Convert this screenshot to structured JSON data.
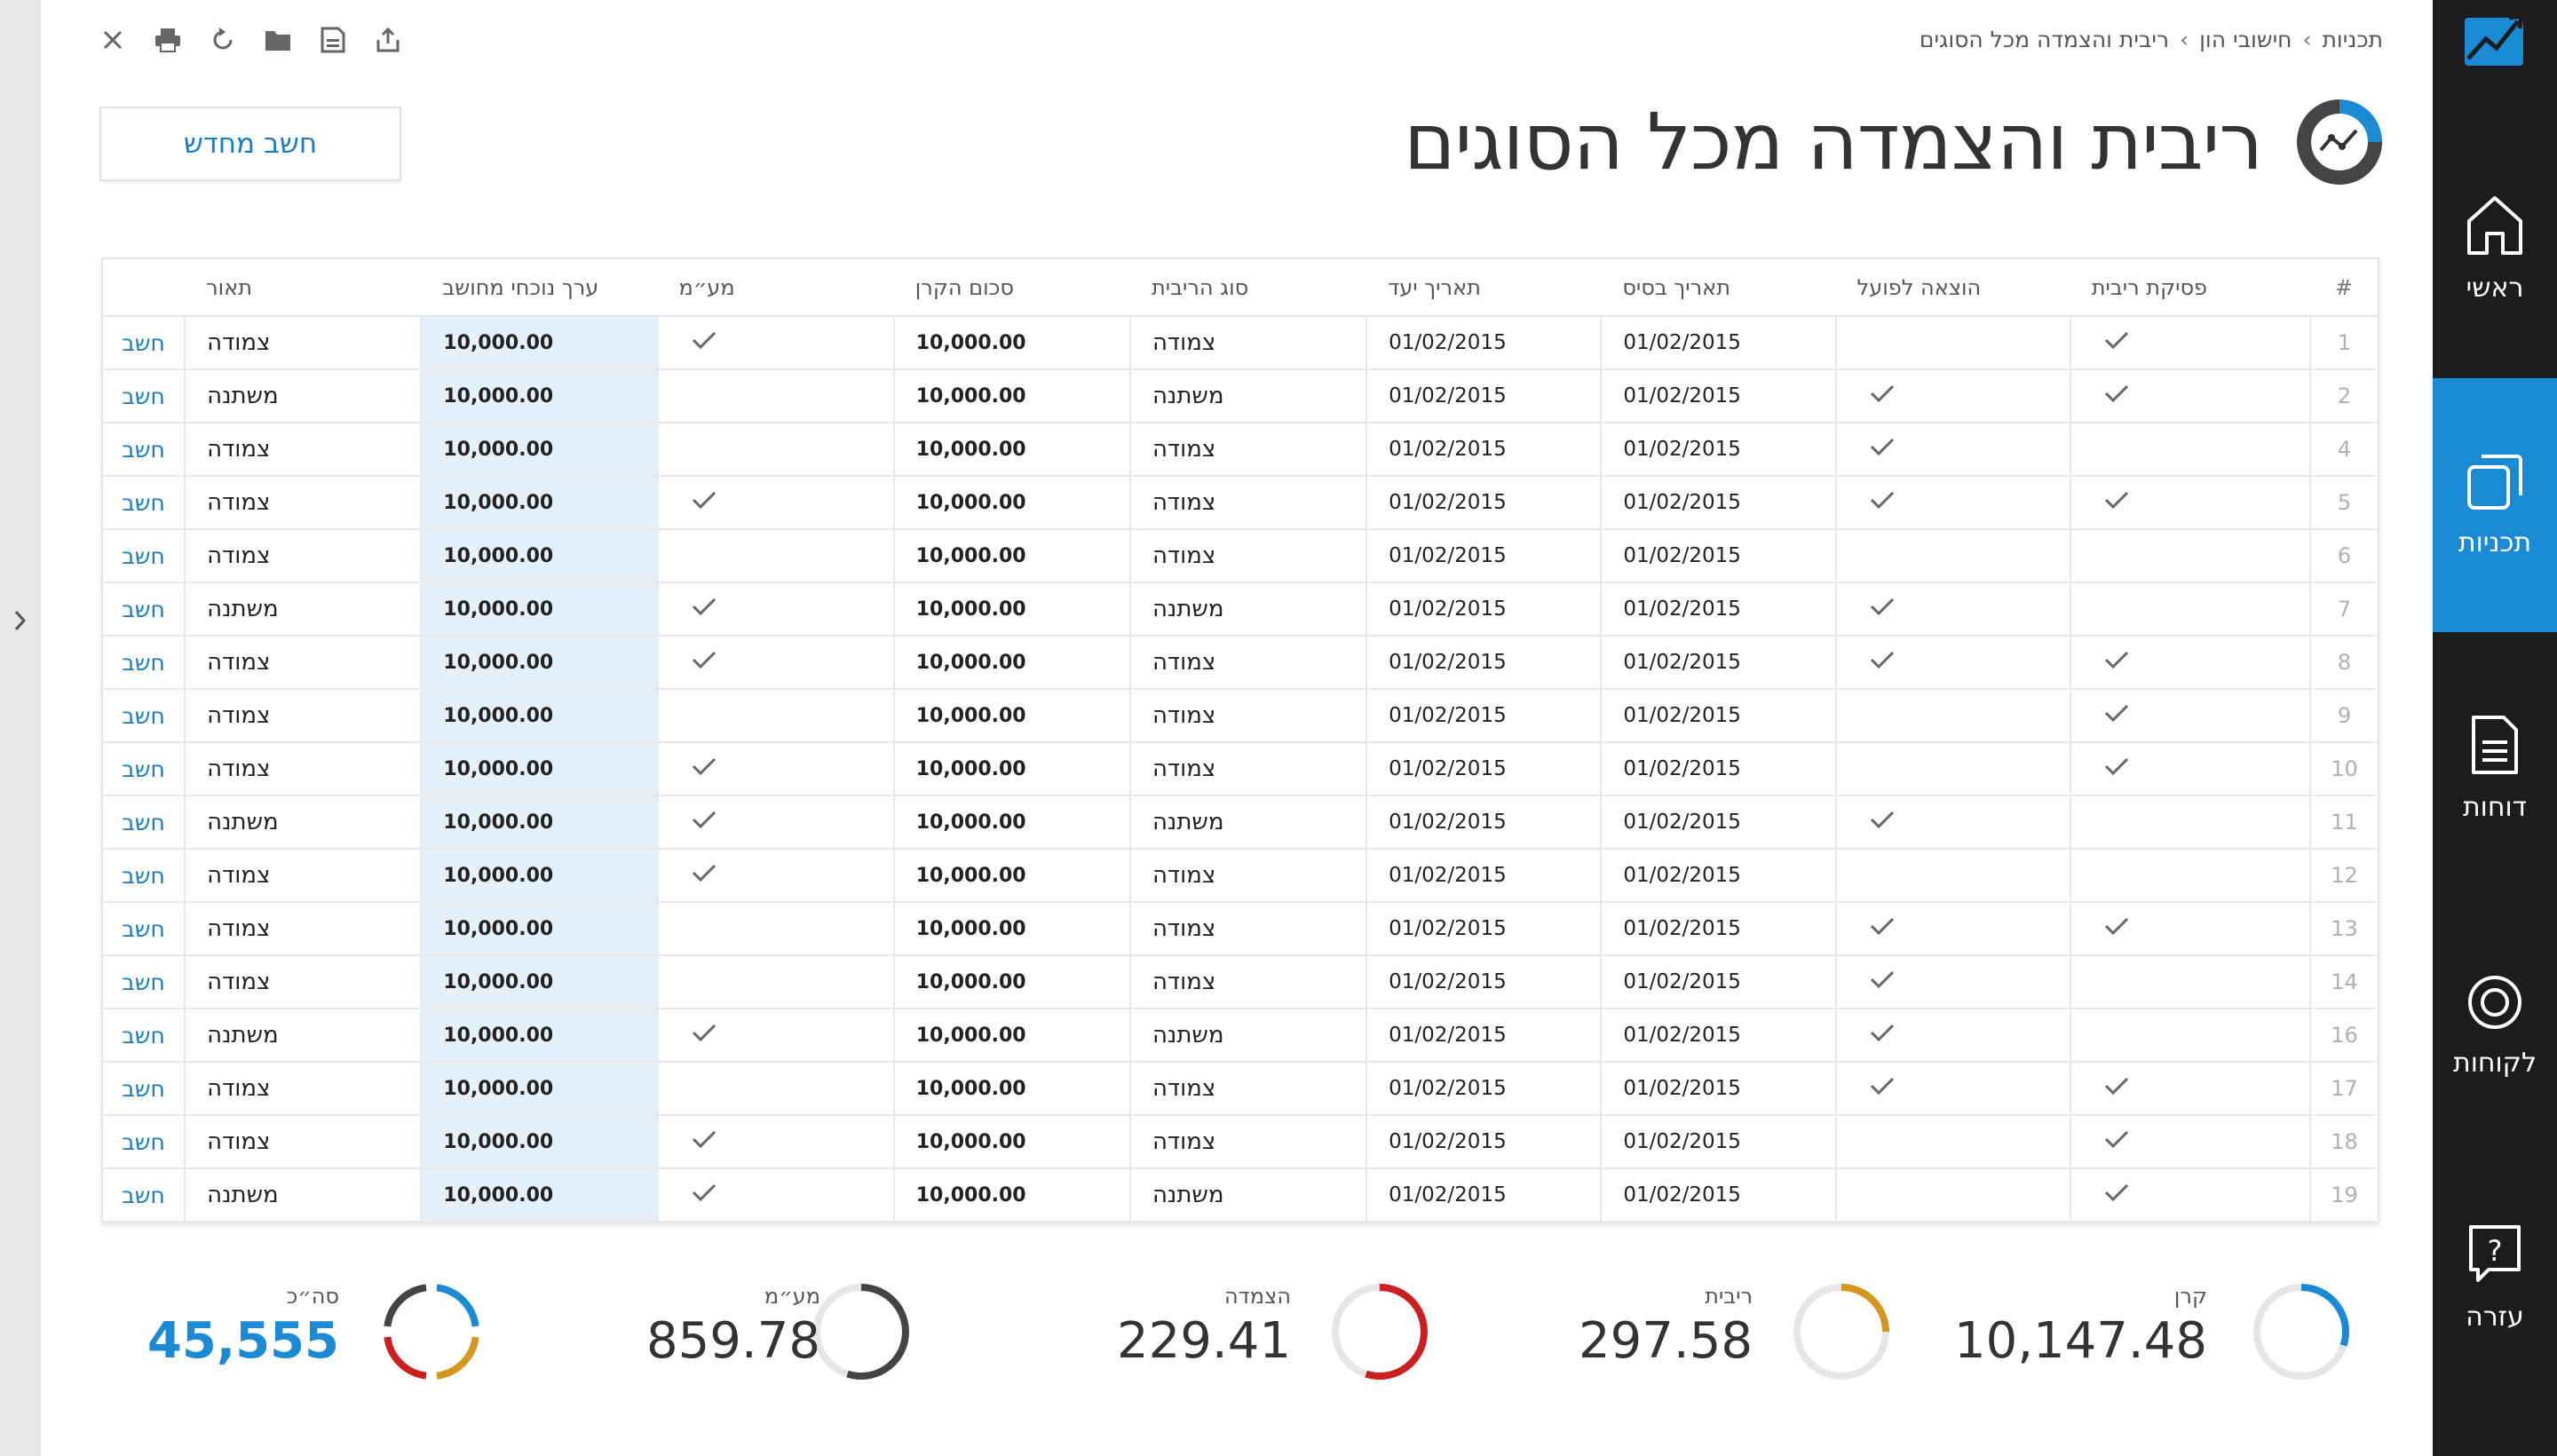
{
  "breadcrumb": {
    "item1": "תכניות",
    "item2": "חישובי הון",
    "item3": "ריבית והצמדה מכל הסוגים",
    "sep": "›"
  },
  "page": {
    "title": "ריבית והצמדה מכל הסוגים",
    "recalc_label": "חשב מחדש"
  },
  "toolbar": {
    "icons": [
      "close-icon",
      "print-icon",
      "refresh-icon",
      "folder-icon",
      "save-icon",
      "share-icon"
    ]
  },
  "nav": {
    "items": [
      {
        "label": "ראשי",
        "icon": "home-icon"
      },
      {
        "label": "תכניות",
        "icon": "copy-icon",
        "active": true
      },
      {
        "label": "דוחות",
        "icon": "document-icon"
      },
      {
        "label": "לקוחות",
        "icon": "circle-icon"
      },
      {
        "label": "עזרה",
        "icon": "help-icon"
      }
    ]
  },
  "table": {
    "headers": {
      "num": "#",
      "stop": "פסיקת ריבית",
      "actual": "הוצאה לפועל",
      "base_date": "תאריך בסיס",
      "target_date": "תאריך יעד",
      "type": "סוג הריבית",
      "principal": "סכום הקרן",
      "vat": "מע״מ",
      "current": "ערך נוכחי מחושב",
      "desc": "תאור"
    },
    "action_label": "חשב",
    "rows": [
      {
        "num": "1",
        "stop": true,
        "actual": false,
        "base": "01/02/2015",
        "target": "01/02/2015",
        "type": "צמודה",
        "principal": "10,000.00",
        "vat": true,
        "current": "10,000.00",
        "desc": "צמודה"
      },
      {
        "num": "2",
        "stop": true,
        "actual": true,
        "base": "01/02/2015",
        "target": "01/02/2015",
        "type": "משתנה",
        "principal": "10,000.00",
        "vat": false,
        "current": "10,000.00",
        "desc": "משתנה"
      },
      {
        "num": "4",
        "stop": false,
        "actual": true,
        "base": "01/02/2015",
        "target": "01/02/2015",
        "type": "צמודה",
        "principal": "10,000.00",
        "vat": false,
        "current": "10,000.00",
        "desc": "צמודה"
      },
      {
        "num": "5",
        "stop": true,
        "actual": true,
        "base": "01/02/2015",
        "target": "01/02/2015",
        "type": "צמודה",
        "principal": "10,000.00",
        "vat": true,
        "current": "10,000.00",
        "desc": "צמודה"
      },
      {
        "num": "6",
        "stop": false,
        "actual": false,
        "base": "01/02/2015",
        "target": "01/02/2015",
        "type": "צמודה",
        "principal": "10,000.00",
        "vat": false,
        "current": "10,000.00",
        "desc": "צמודה"
      },
      {
        "num": "7",
        "stop": false,
        "actual": true,
        "base": "01/02/2015",
        "target": "01/02/2015",
        "type": "משתנה",
        "principal": "10,000.00",
        "vat": true,
        "current": "10,000.00",
        "desc": "משתנה"
      },
      {
        "num": "8",
        "stop": true,
        "actual": true,
        "base": "01/02/2015",
        "target": "01/02/2015",
        "type": "צמודה",
        "principal": "10,000.00",
        "vat": true,
        "current": "10,000.00",
        "desc": "צמודה"
      },
      {
        "num": "9",
        "stop": true,
        "actual": false,
        "base": "01/02/2015",
        "target": "01/02/2015",
        "type": "צמודה",
        "principal": "10,000.00",
        "vat": false,
        "current": "10,000.00",
        "desc": "צמודה"
      },
      {
        "num": "10",
        "stop": true,
        "actual": false,
        "base": "01/02/2015",
        "target": "01/02/2015",
        "type": "צמודה",
        "principal": "10,000.00",
        "vat": true,
        "current": "10,000.00",
        "desc": "צמודה"
      },
      {
        "num": "11",
        "stop": false,
        "actual": true,
        "base": "01/02/2015",
        "target": "01/02/2015",
        "type": "משתנה",
        "principal": "10,000.00",
        "vat": true,
        "current": "10,000.00",
        "desc": "משתנה"
      },
      {
        "num": "12",
        "stop": false,
        "actual": false,
        "base": "01/02/2015",
        "target": "01/02/2015",
        "type": "צמודה",
        "principal": "10,000.00",
        "vat": true,
        "current": "10,000.00",
        "desc": "צמודה"
      },
      {
        "num": "13",
        "stop": true,
        "actual": true,
        "base": "01/02/2015",
        "target": "01/02/2015",
        "type": "צמודה",
        "principal": "10,000.00",
        "vat": false,
        "current": "10,000.00",
        "desc": "צמודה"
      },
      {
        "num": "14",
        "stop": false,
        "actual": true,
        "base": "01/02/2015",
        "target": "01/02/2015",
        "type": "צמודה",
        "principal": "10,000.00",
        "vat": false,
        "current": "10,000.00",
        "desc": "צמודה"
      },
      {
        "num": "16",
        "stop": false,
        "actual": true,
        "base": "01/02/2015",
        "target": "01/02/2015",
        "type": "משתנה",
        "principal": "10,000.00",
        "vat": true,
        "current": "10,000.00",
        "desc": "משתנה"
      },
      {
        "num": "17",
        "stop": true,
        "actual": true,
        "base": "01/02/2015",
        "target": "01/02/2015",
        "type": "צמודה",
        "principal": "10,000.00",
        "vat": false,
        "current": "10,000.00",
        "desc": "צמודה"
      },
      {
        "num": "18",
        "stop": true,
        "actual": false,
        "base": "01/02/2015",
        "target": "01/02/2015",
        "type": "צמודה",
        "principal": "10,000.00",
        "vat": true,
        "current": "10,000.00",
        "desc": "צמודה"
      },
      {
        "num": "19",
        "stop": true,
        "actual": false,
        "base": "01/02/2015",
        "target": "01/02/2015",
        "type": "משתנה",
        "principal": "10,000.00",
        "vat": true,
        "current": "10,000.00",
        "desc": "משתנה"
      }
    ]
  },
  "summary": {
    "principal": {
      "label": "קרן",
      "value": "10,147.48",
      "color": "#1a8ad4",
      "fraction": 0.3
    },
    "interest": {
      "label": "ריבית",
      "value": "297.58",
      "color": "#d4961e",
      "fraction": 0.25
    },
    "indexation": {
      "label": "הצמדה",
      "value": "229.41",
      "color": "#cc1f1f",
      "fraction": 0.55
    },
    "vat": {
      "label": "מע״מ",
      "value": "859.78",
      "color": "#444444",
      "fraction": 0.55
    },
    "total": {
      "label": "סה״כ",
      "value": "45,555",
      "colors": [
        "#1a8ad4",
        "#d4961e",
        "#cc1f1f",
        "#444444"
      ]
    }
  },
  "colors": {
    "accent": "#1a8ad4",
    "nav_bg": "#1c1c1e",
    "current_col_bg": "#e4f1fa"
  }
}
